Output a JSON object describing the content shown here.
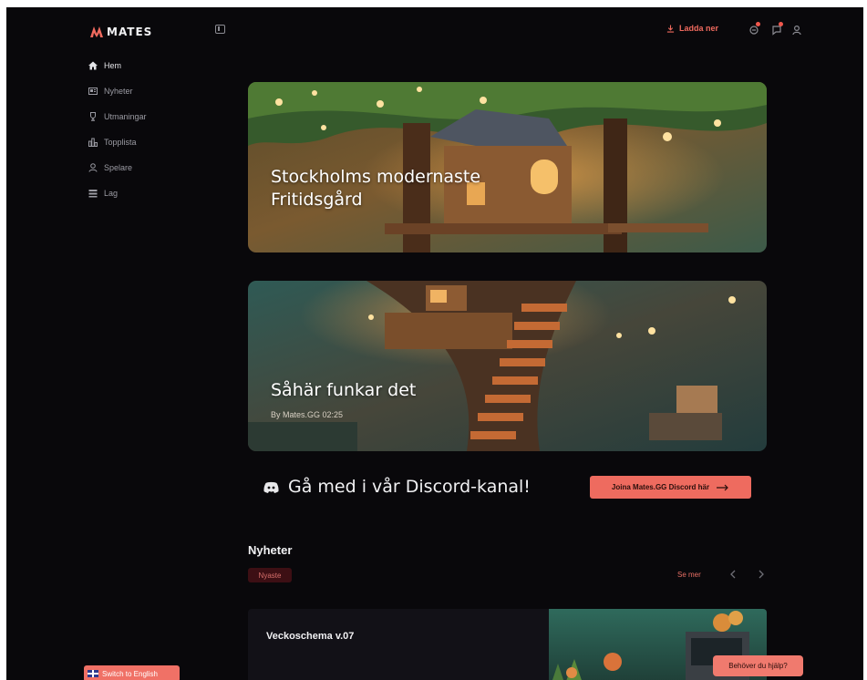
{
  "brand": {
    "name": "MATES",
    "logo_icon": "mates-logo-icon",
    "accent": "#f06a5e"
  },
  "sidebar": {
    "collapse_icon": "sidebar-toggle-icon",
    "items": [
      {
        "label": "Hem",
        "icon": "home-icon",
        "active": true
      },
      {
        "label": "Nyheter",
        "icon": "newspaper-icon",
        "active": false
      },
      {
        "label": "Utmaningar",
        "icon": "trophy-icon",
        "active": false
      },
      {
        "label": "Topplista",
        "icon": "leaderboard-icon",
        "active": false
      },
      {
        "label": "Spelare",
        "icon": "user-icon",
        "active": false
      },
      {
        "label": "Lag",
        "icon": "team-icon",
        "active": false
      }
    ],
    "switch_language_label": "Switch to English"
  },
  "topbar": {
    "download_label": "Ladda ner",
    "icons": [
      "notification-icon",
      "message-icon",
      "profile-icon"
    ]
  },
  "hero_cards": [
    {
      "title_line1": "Stockholms modernaste",
      "title_line2": "Fritidsgård"
    },
    {
      "title": "Såhär funkar det",
      "meta": "By Mates.GG 02:25"
    }
  ],
  "discord": {
    "text": "Gå med i vår Discord-kanal!",
    "button_label": "Joina Mates.GG Discord här"
  },
  "news": {
    "section_title": "Nyheter",
    "filter_tag": "Nyaste",
    "see_more": "Se mer",
    "items": [
      {
        "title": "Veckoschema v.07"
      }
    ]
  },
  "help_button": "Behöver du hjälp?"
}
